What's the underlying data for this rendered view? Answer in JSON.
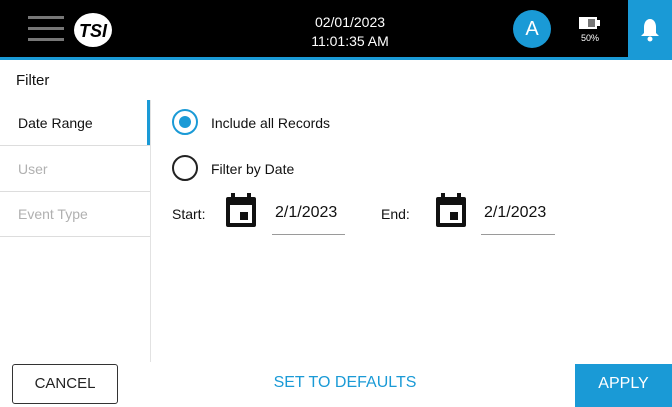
{
  "header": {
    "date": "02/01/2023",
    "time": "11:01:35 AM",
    "avatar_letter": "A",
    "battery_pct": "50%",
    "menu_icon": "hamburger-menu-icon",
    "logo_icon": "tsi-logo-icon",
    "bell_icon": "notification-bell-icon",
    "accent_color": "#1a9ad6"
  },
  "page": {
    "title": "Filter"
  },
  "sidebar": {
    "items": [
      {
        "label": "Date Range",
        "active": true
      },
      {
        "label": "User",
        "active": false
      },
      {
        "label": "Event Type",
        "active": false
      }
    ]
  },
  "main": {
    "options": [
      {
        "label": "Include all Records",
        "selected": true
      },
      {
        "label": "Filter by Date",
        "selected": false
      }
    ],
    "start": {
      "label": "Start:",
      "value": "2/1/2023"
    },
    "end": {
      "label": "End:",
      "value": "2/1/2023"
    }
  },
  "footer": {
    "cancel": "CANCEL",
    "defaults": "SET TO DEFAULTS",
    "apply": "APPLY"
  }
}
